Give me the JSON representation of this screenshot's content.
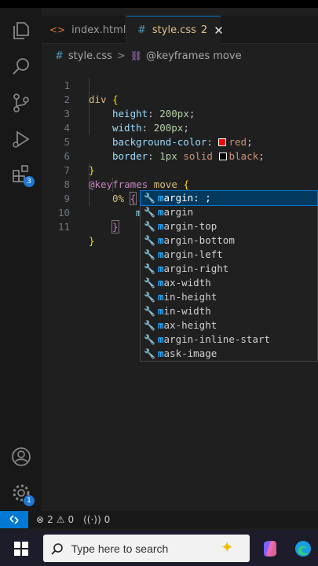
{
  "tabs": [
    {
      "label": "index.html",
      "icon": "html-file-icon"
    },
    {
      "label": "style.css",
      "count": "2",
      "icon": "css-file-icon",
      "close": "✕"
    }
  ],
  "breadcrumb": {
    "file": "style.css",
    "separator": ">",
    "symbol": "@keyframes move"
  },
  "editor": {
    "lines": [
      {
        "n": "1"
      },
      {
        "n": "2"
      },
      {
        "n": "3"
      },
      {
        "n": "4"
      },
      {
        "n": "5"
      },
      {
        "n": "6"
      },
      {
        "n": "7"
      },
      {
        "n": "8"
      },
      {
        "n": "9"
      },
      {
        "n": "10"
      },
      {
        "n": "11"
      }
    ],
    "code": {
      "l1_sel": "div",
      "l1_brace": "{",
      "l2_prop": "height",
      "l2_val": "200px",
      "l3_prop": "width",
      "l3_val": "200px",
      "l4_prop": "background-color",
      "l4_val": "red",
      "l5_prop": "border",
      "l5_val1": "1px",
      "l5_val2": "solid",
      "l5_val3": "black",
      "l6_brace": "}",
      "l7_at": "@keyframes",
      "l7_name": "move",
      "l7_brace": "{",
      "l8_pct": "0%",
      "l8_brace": "{",
      "l9_typed": "m",
      "l10_brace": "}",
      "l11_brace": "}"
    }
  },
  "suggestions": [
    "margin: ;",
    "margin",
    "margin-top",
    "margin-bottom",
    "margin-left",
    "margin-right",
    "max-width",
    "min-height",
    "min-width",
    "max-height",
    "margin-inline-start",
    "mask-image"
  ],
  "activity_bar": {
    "extensions_badge": "3",
    "settings_badge": "1"
  },
  "status": {
    "errors": "2",
    "warnings": "0",
    "ports": "0"
  },
  "taskbar": {
    "search_placeholder": "Type here to search"
  },
  "colors": {
    "accent": "#0078d4",
    "swatch_red": "#ff0000",
    "swatch_black": "#000000"
  }
}
